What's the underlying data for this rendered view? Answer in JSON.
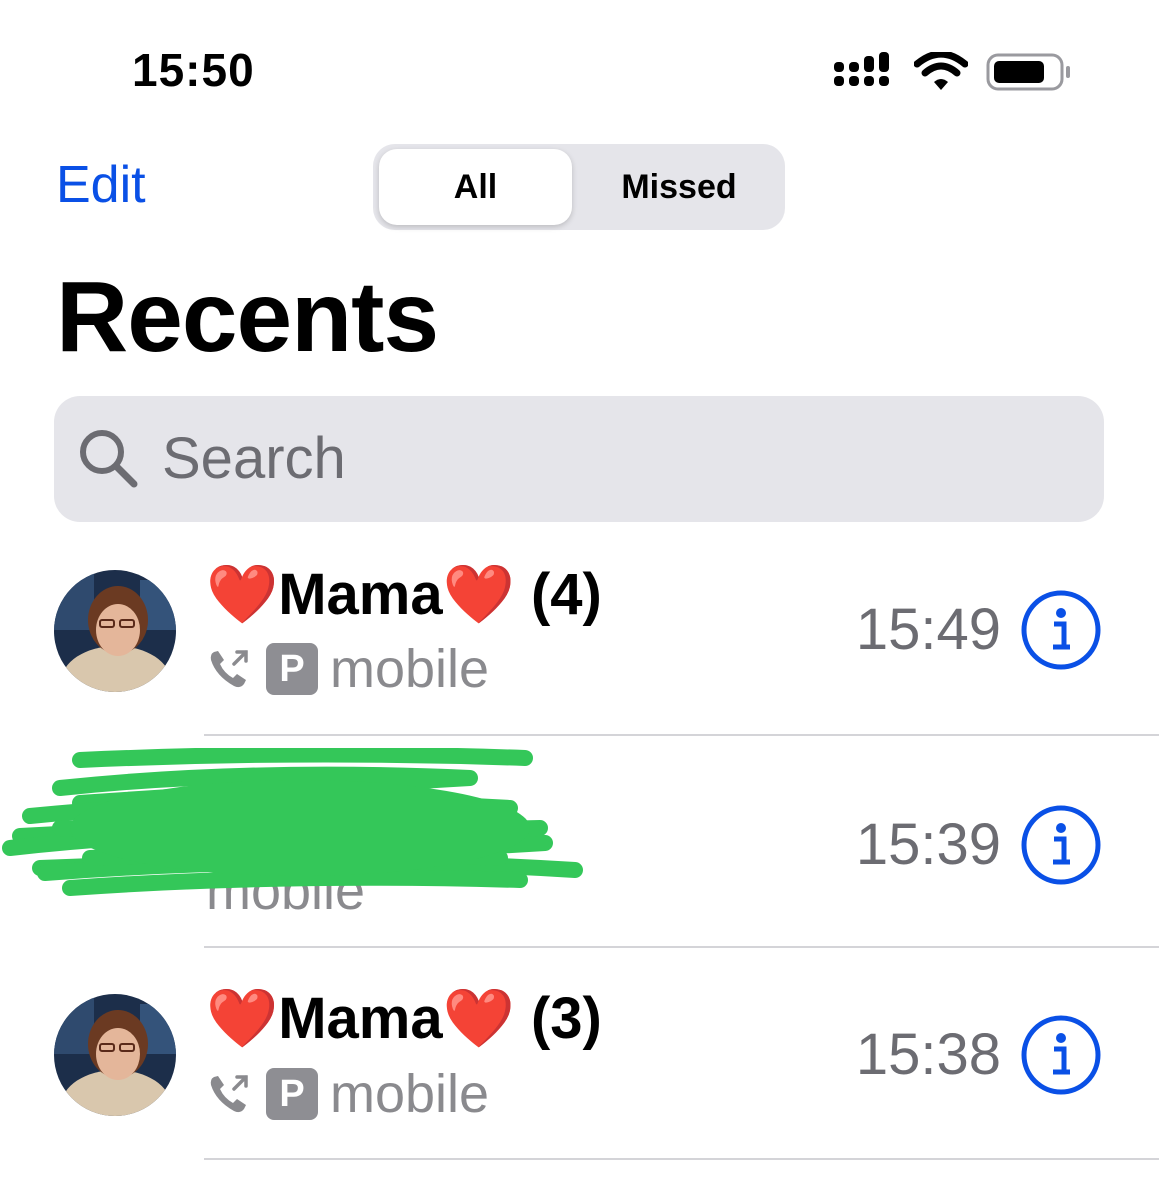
{
  "status_bar": {
    "time": "15:50",
    "icons": [
      "cellular-signal-icon",
      "wifi-icon",
      "battery-icon"
    ]
  },
  "header": {
    "edit_label": "Edit",
    "segments": [
      "All",
      "Missed"
    ],
    "selected_segment": "All",
    "title": "Recents"
  },
  "search": {
    "placeholder": "Search"
  },
  "calls": [
    {
      "name": "Mama",
      "count": "(4)",
      "heart": "❤️",
      "badge": "P",
      "type": "mobile",
      "time": "15:49",
      "redacted": false
    },
    {
      "name": "",
      "count": "",
      "type": "mobile",
      "time": "15:39",
      "redacted": true
    },
    {
      "name": "Mama",
      "count": "(3)",
      "heart": "❤️",
      "badge": "P",
      "type": "mobile",
      "time": "15:38",
      "redacted": false
    }
  ],
  "colors": {
    "accent": "#0a50e6",
    "heart": "#e0151f",
    "redaction": "#34c759",
    "secondary_text": "#8a8a8e",
    "search_bg": "#e5e5ea"
  }
}
